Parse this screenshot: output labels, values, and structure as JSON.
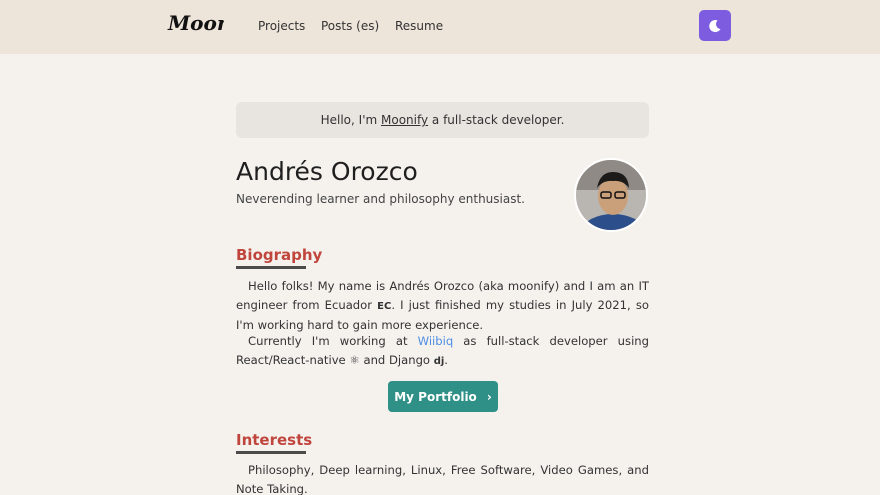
{
  "nav": {
    "logo_text": "Moonfy",
    "links": [
      "Projects",
      "Posts (es)",
      "Resume"
    ],
    "theme_icon": "moon-icon"
  },
  "hello": {
    "prefix": "Hello, I'm ",
    "brand": "Moonify",
    "suffix": " a full-stack developer."
  },
  "profile": {
    "name": "Andrés Orozco",
    "tagline": "Neverending learner and philosophy enthusiast."
  },
  "biography": {
    "title": "Biography",
    "p1_a": "Hello folks! My name is Andrés Orozco (aka moonify) and I am an IT engineer from Ecuador ",
    "p1_badge": "EC",
    "p1_b": ". I just finished my studies in July 2021, so I'm working hard to gain more experience.",
    "p2_a": "Currently I'm working at ",
    "p2_link": "Wiibiq",
    "p2_b": " as full-stack developer using React/React-native ",
    "p2_c": " and Django ",
    "p2_badge": "dj",
    "p2_d": "."
  },
  "portfolio_button": {
    "label": "My Portfolio",
    "icon": "chevron-right-icon"
  },
  "interests": {
    "title": "Interests",
    "text": "Philosophy, Deep learning, Linux, Free Software, Video Games, and Note Taking."
  }
}
